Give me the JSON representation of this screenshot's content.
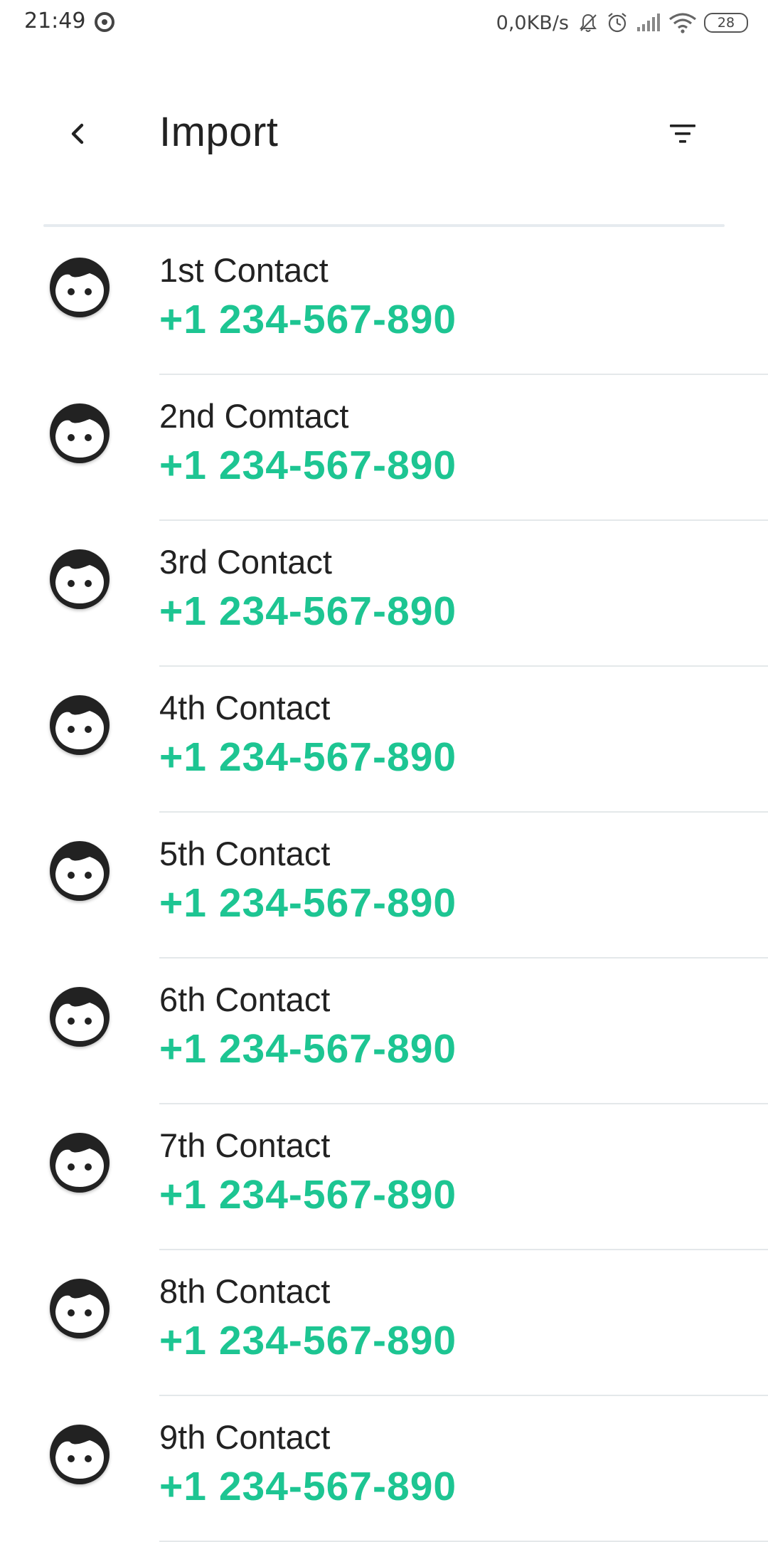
{
  "status_bar": {
    "time": "21:49",
    "net_speed": "0,0KB/s",
    "battery": "28"
  },
  "header": {
    "title": "Import",
    "back_icon": "chevron-left-icon",
    "filter_icon": "filter-icon"
  },
  "accent_color": "#1dc592",
  "contacts": [
    {
      "name": "1st Contact",
      "phone": "+1 234-567-890"
    },
    {
      "name": "2nd Comtact",
      "phone": "+1 234-567-890"
    },
    {
      "name": "3rd Contact",
      "phone": "+1 234-567-890"
    },
    {
      "name": "4th Contact",
      "phone": "+1 234-567-890"
    },
    {
      "name": "5th Contact",
      "phone": "+1 234-567-890"
    },
    {
      "name": "6th Contact",
      "phone": "+1 234-567-890"
    },
    {
      "name": "7th Contact",
      "phone": "+1 234-567-890"
    },
    {
      "name": "8th Contact",
      "phone": "+1 234-567-890"
    },
    {
      "name": "9th Contact",
      "phone": "+1 234-567-890"
    }
  ]
}
